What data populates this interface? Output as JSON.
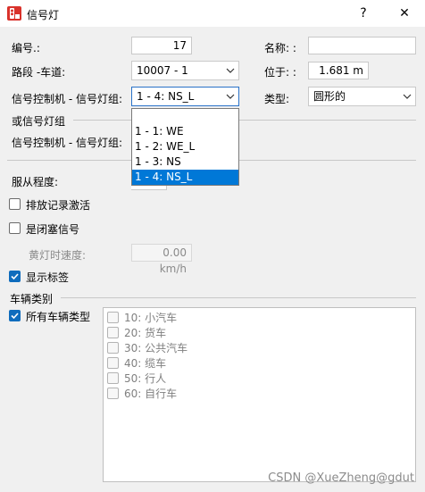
{
  "window": {
    "title": "信号灯",
    "help": "?",
    "close": "✕"
  },
  "fields": {
    "number_label": "编号.:",
    "number_value": "17",
    "name_label": "名称: :",
    "name_value": "",
    "link_lane_label": "路段 -车道:",
    "link_lane_value": "10007 - 1",
    "position_label": "位于: :",
    "position_value": "1.681 m",
    "controller_label": "信号控制机 - 信号灯组:",
    "controller_value": "1 - 4: NS_L",
    "type_label": "类型:",
    "type_value": "圆形的"
  },
  "or_group": {
    "heading": "或信号灯组",
    "controller_label": "信号控制机 - 信号灯组:"
  },
  "dropdown_options": [
    {
      "label": "",
      "selected": false
    },
    {
      "label": "1 - 1: WE",
      "selected": false
    },
    {
      "label": "1 - 2: WE_L",
      "selected": false
    },
    {
      "label": "1 - 3: NS",
      "selected": false
    },
    {
      "label": "1 - 4: NS_L",
      "selected": true
    }
  ],
  "compliance_label": "服从程度:",
  "checks": {
    "discharge_record": {
      "label": "排放记录激活",
      "checked": false
    },
    "block_signal": {
      "label": "是闭塞信号",
      "checked": false
    },
    "amber_speed_label": "黄灯时速度:",
    "amber_speed_value": "0.00 km/h",
    "show_label": {
      "label": "显示标签",
      "checked": true
    }
  },
  "vehicle": {
    "heading": "车辆类别",
    "all_types": {
      "label": "所有车辆类型",
      "checked": true
    },
    "classes": [
      {
        "label": "10: 小汽车",
        "checked": false
      },
      {
        "label": "20: 货车",
        "checked": false
      },
      {
        "label": "30: 公共汽车",
        "checked": false
      },
      {
        "label": "40: 缆车",
        "checked": false
      },
      {
        "label": "50: 行人",
        "checked": false
      },
      {
        "label": "60: 自行车",
        "checked": false
      }
    ]
  },
  "watermark": "CSDN @XueZheng@gdut",
  "colors": {
    "accent": "#0f6cbd",
    "selection": "#0078d7",
    "focus_border": "#2a72c8",
    "icon_red": "#d9322b"
  }
}
